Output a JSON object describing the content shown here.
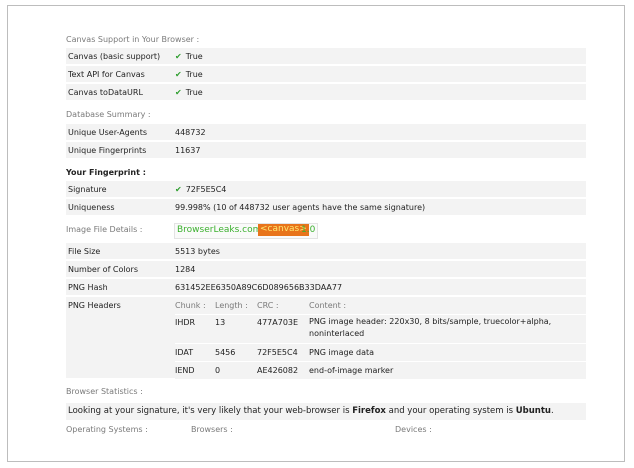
{
  "canvas_support": {
    "title": "Canvas Support in Your Browser :",
    "rows": [
      {
        "label": "Canvas (basic support)",
        "value": "True"
      },
      {
        "label": "Text API for Canvas",
        "value": "True"
      },
      {
        "label": "Canvas toDataURL",
        "value": "True"
      }
    ]
  },
  "database": {
    "title": "Database Summary :",
    "rows": [
      {
        "label": "Unique User-Agents",
        "value": "448732"
      },
      {
        "label": "Unique Fingerprints",
        "value": "11637"
      }
    ]
  },
  "fingerprint": {
    "title": "Your Fingerprint :",
    "signature_label": "Signature",
    "signature_value": "72F5E5C4",
    "uniqueness_label": "Uniqueness",
    "uniqueness_value": "99.998% (10 of 448732 user agents have the same signature)"
  },
  "image_file": {
    "title": "Image File Details :",
    "badge": {
      "part1": "BrowserLeaks.com",
      "part2": "<canvas>",
      "part3": "1.0"
    },
    "rows": [
      {
        "label": "File Size",
        "value": "5513 bytes"
      },
      {
        "label": "Number of Colors",
        "value": "1284"
      },
      {
        "label": "PNG Hash",
        "value": "631452EE6350A89C6D089656B33DAA77"
      }
    ],
    "png_headers_label": "PNG Headers",
    "chunk_headers": {
      "chunk": "Chunk :",
      "length": "Length :",
      "crc": "CRC :",
      "content": "Content :"
    },
    "chunks": [
      {
        "chunk": "IHDR",
        "length": "13",
        "crc": "477A703E",
        "content": "PNG image header: 220x30, 8 bits/sample, truecolor+alpha, noninterlaced"
      },
      {
        "chunk": "IDAT",
        "length": "5456",
        "crc": "72F5E5C4",
        "content": "PNG image data"
      },
      {
        "chunk": "IEND",
        "length": "0",
        "crc": "AE426082",
        "content": "end-of-image marker"
      }
    ]
  },
  "browser_stats": {
    "title": "Browser Statistics :",
    "sentence_pre": "Looking at your signature, it's very likely that your web-browser is ",
    "browser": "Firefox",
    "sentence_mid": " and your operating system is ",
    "os": "Ubuntu",
    "sentence_end": ".",
    "col_os": "Operating Systems :",
    "col_browsers": "Browsers :",
    "col_devices": "Devices :"
  },
  "colors": {
    "check": "#2e9e2e",
    "badge_green": "#3cb02f",
    "badge_orange": "#e8741b"
  },
  "icons": {
    "check": "check-icon"
  }
}
